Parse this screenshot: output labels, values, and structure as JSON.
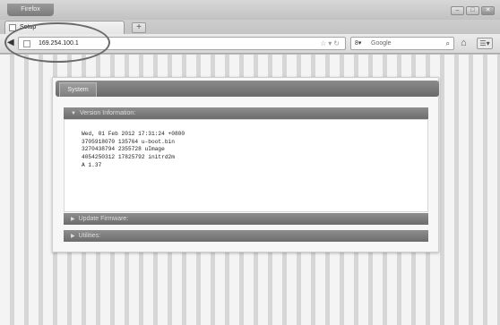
{
  "browser": {
    "app_button_label": "Firefox",
    "window_controls": [
      "–",
      "□",
      "✕"
    ],
    "tab_title": "Setup",
    "new_tab_label": "+",
    "address": "169.254.100.1",
    "search_engine_label": "8",
    "search_placeholder": "Google",
    "icons": {
      "back": "back-arrow-icon",
      "home": "home-icon",
      "menu": "menu-icon",
      "search": "search-icon",
      "bookmark": "star-icon",
      "reload": "reload-icon"
    }
  },
  "page": {
    "system_tab_label": "System",
    "sections": {
      "version": {
        "title": "Version Information:",
        "lines": [
          "Wed, 01 Feb 2012 17:31:24 +0800",
          "3705918070 135764 u-boot.bin",
          "3270438794 2355728 uImage",
          "4054250312 17825792 initrd2m",
          "A 1.37"
        ]
      },
      "firmware": {
        "title": "Update Firmware:"
      },
      "utilities": {
        "title": "Utilities:"
      }
    }
  },
  "colors": {
    "header_bar": "#7a7a7a",
    "section_bar": "#7c7c7c",
    "page_stripe_light": "#f4f4f4",
    "page_stripe_dark": "#d6d6d6"
  }
}
